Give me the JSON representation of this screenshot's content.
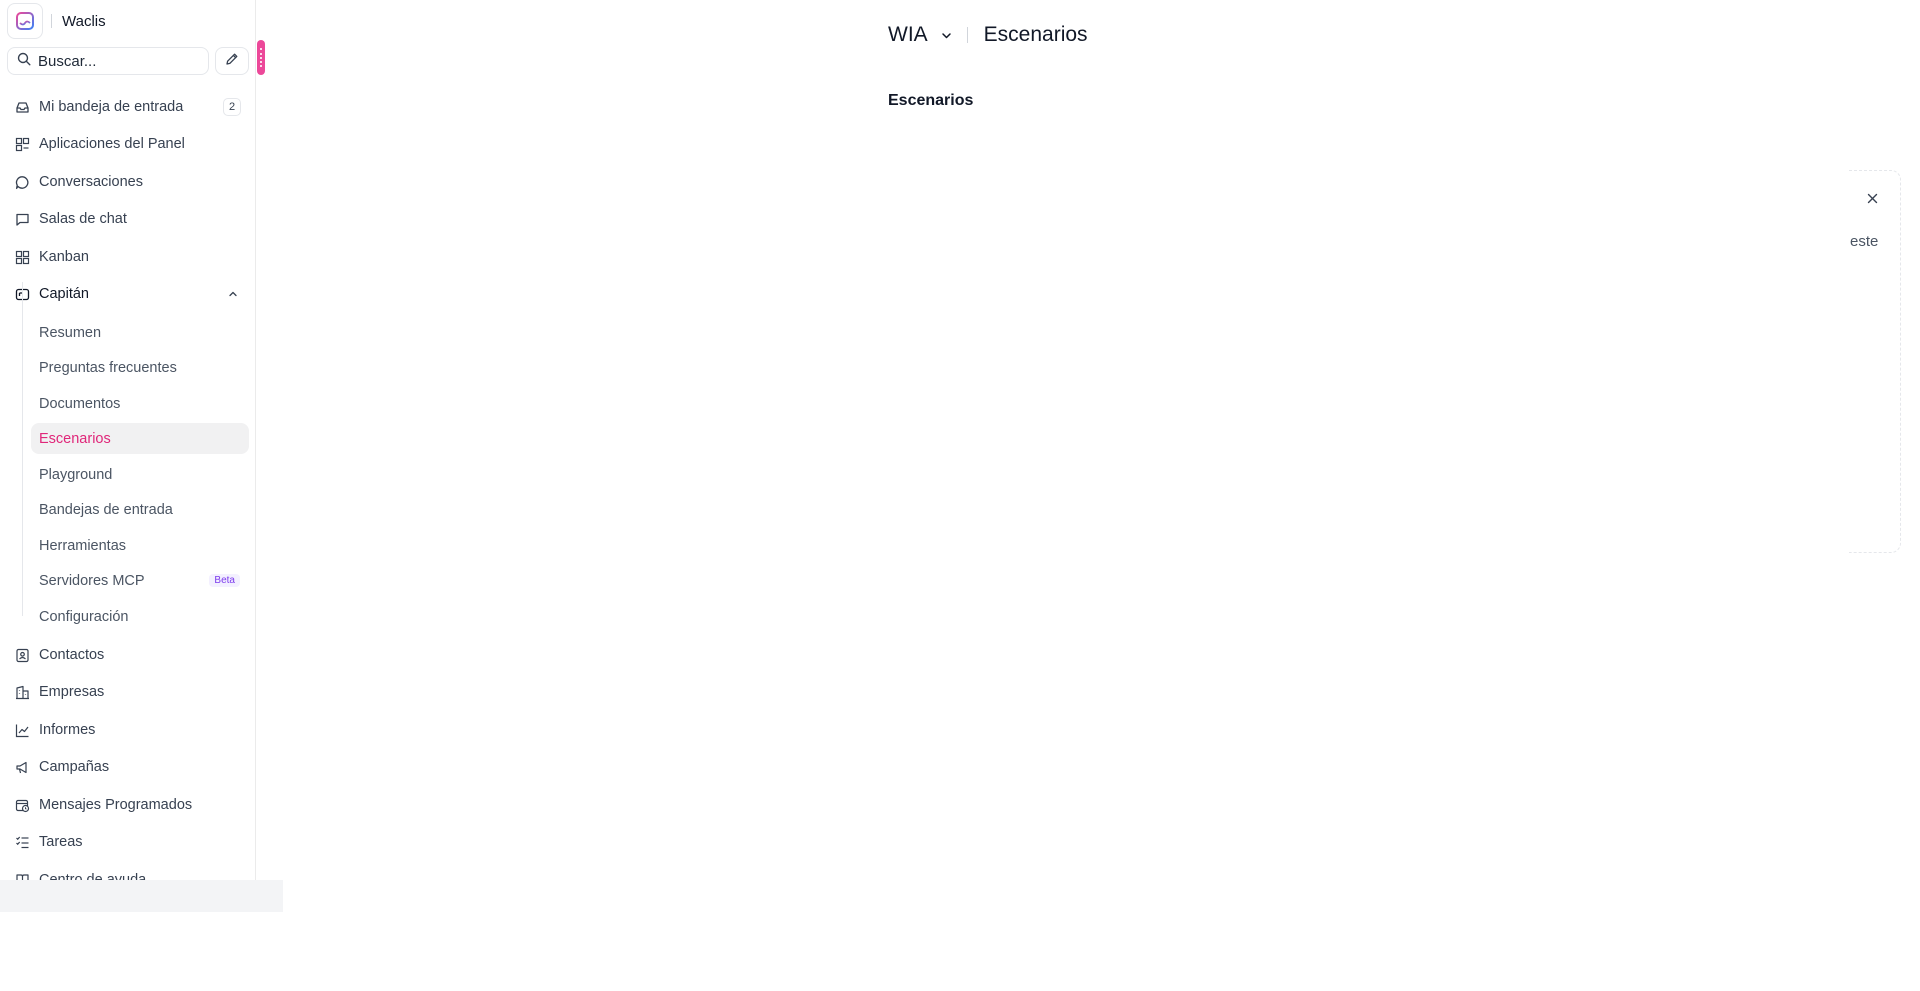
{
  "brand": {
    "name": "Waclis"
  },
  "search": {
    "placeholder": "Buscar..."
  },
  "nav": {
    "inbox": {
      "label": "Mi bandeja de entrada",
      "count": "2"
    },
    "dashboard_apps": {
      "label": "Aplicaciones del Panel"
    },
    "conversations": {
      "label": "Conversaciones"
    },
    "chat_rooms": {
      "label": "Salas de chat"
    },
    "kanban": {
      "label": "Kanban"
    },
    "captain": {
      "label": "Capitán"
    },
    "captain_items": [
      {
        "label": "Resumen"
      },
      {
        "label": "Preguntas frecuentes"
      },
      {
        "label": "Documentos"
      },
      {
        "label": "Escenarios"
      },
      {
        "label": "Playground"
      },
      {
        "label": "Bandejas de entrada"
      },
      {
        "label": "Herramientas"
      },
      {
        "label": "Servidores MCP",
        "badge": "Beta"
      },
      {
        "label": "Configuración"
      }
    ],
    "contacts": {
      "label": "Contactos"
    },
    "companies": {
      "label": "Empresas"
    },
    "reports": {
      "label": "Informes"
    },
    "campaigns": {
      "label": "Campañas"
    },
    "scheduled": {
      "label": "Mensajes Programados"
    },
    "tasks": {
      "label": "Tareas"
    },
    "help_center": {
      "label": "Centro de ayuda"
    }
  },
  "header": {
    "workspace": "WIA",
    "title": "Escenarios"
  },
  "main": {
    "section_title": "Escenarios",
    "panel_text": "este"
  },
  "colors": {
    "accent": "#e0277a",
    "handle": "#ec4899"
  }
}
